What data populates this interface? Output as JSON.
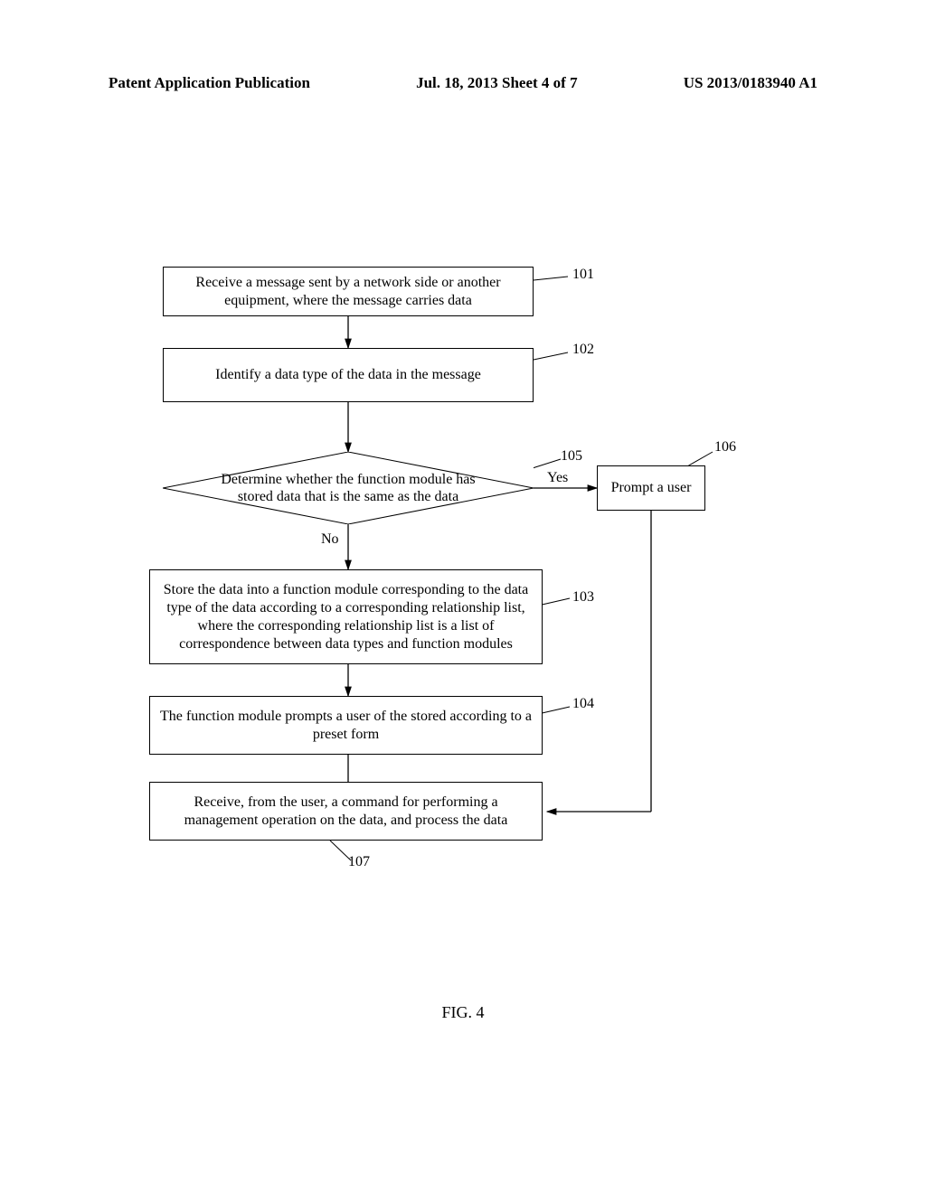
{
  "header": {
    "left": "Patent Application Publication",
    "center": "Jul. 18, 2013  Sheet 4 of 7",
    "right": "US 2013/0183940 A1"
  },
  "steps": {
    "s101": {
      "num": "101",
      "text": "Receive a message sent by a network side or another equipment, where the message carries data"
    },
    "s102": {
      "num": "102",
      "text": "Identify a data type of the data in the message"
    },
    "s105": {
      "num": "105",
      "text": "Determine whether the function module has stored data that is the same as the data"
    },
    "s106": {
      "num": "106",
      "text": "Prompt a user"
    },
    "s103": {
      "num": "103",
      "text": "Store the data into a function module corresponding to the data type of the data according to a corresponding relationship list, where the corresponding relationship list is a list of correspondence between data types and function modules"
    },
    "s104": {
      "num": "104",
      "text": "The function module prompts a user of the stored according to a preset form"
    },
    "s107": {
      "num": "107",
      "text": "Receive, from the user, a command for performing a management operation on the data, and process the data"
    }
  },
  "decision": {
    "yes": "Yes",
    "no": "No"
  },
  "figure": "FIG. 4",
  "chart_data": {
    "type": "flowchart",
    "nodes": [
      {
        "id": "101",
        "shape": "process",
        "text": "Receive a message sent by a network side or another equipment, where the message carries data"
      },
      {
        "id": "102",
        "shape": "process",
        "text": "Identify a data type of the data in the message"
      },
      {
        "id": "105",
        "shape": "decision",
        "text": "Determine whether the function module has stored data that is the same as the data"
      },
      {
        "id": "106",
        "shape": "process",
        "text": "Prompt a user"
      },
      {
        "id": "103",
        "shape": "process",
        "text": "Store the data into a function module corresponding to the data type of the data according to a corresponding relationship list, where the corresponding relationship list is a list of correspondence between data types and function modules"
      },
      {
        "id": "104",
        "shape": "process",
        "text": "The function module prompts a user of the stored according to a preset form"
      },
      {
        "id": "107",
        "shape": "process",
        "text": "Receive, from the user, a command for performing a management operation on the data, and process the data"
      }
    ],
    "edges": [
      {
        "from": "101",
        "to": "102"
      },
      {
        "from": "102",
        "to": "105"
      },
      {
        "from": "105",
        "to": "106",
        "label": "Yes"
      },
      {
        "from": "105",
        "to": "103",
        "label": "No"
      },
      {
        "from": "103",
        "to": "104"
      },
      {
        "from": "104",
        "to": "107"
      },
      {
        "from": "106",
        "to": "107"
      }
    ]
  }
}
